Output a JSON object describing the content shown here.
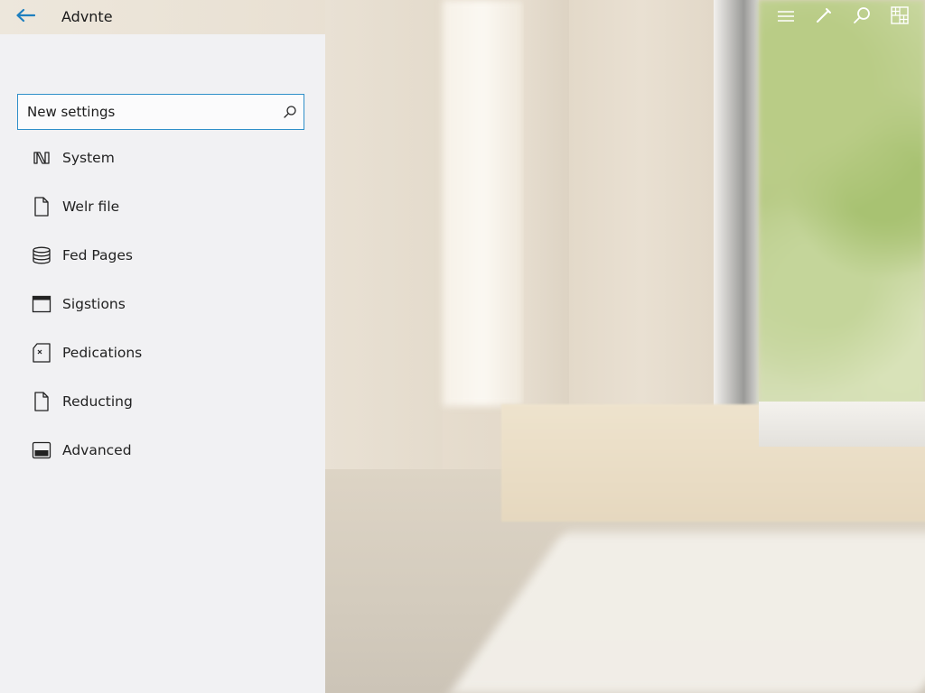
{
  "header": {
    "title": "Advnte",
    "back_icon": "back-arrow-icon",
    "right_icons": [
      "list-icon",
      "pencil-icon",
      "search-icon",
      "grid-icon"
    ]
  },
  "search": {
    "placeholder": "New settings",
    "icon": "search-icon"
  },
  "nav": {
    "items": [
      {
        "label": "System",
        "icon": "system-icon"
      },
      {
        "label": "Welr file",
        "icon": "file-icon"
      },
      {
        "label": "Fed Pages",
        "icon": "database-icon"
      },
      {
        "label": "Sigstions",
        "icon": "window-icon"
      },
      {
        "label": "Pedications",
        "icon": "tag-file-icon"
      },
      {
        "label": "Reducting",
        "icon": "document-icon"
      },
      {
        "label": "Advanced",
        "icon": "panel-icon"
      }
    ]
  },
  "colors": {
    "accent": "#2f8fc9",
    "panel_bg": "#f1f1f3",
    "back_arrow": "#1e7fbf"
  }
}
